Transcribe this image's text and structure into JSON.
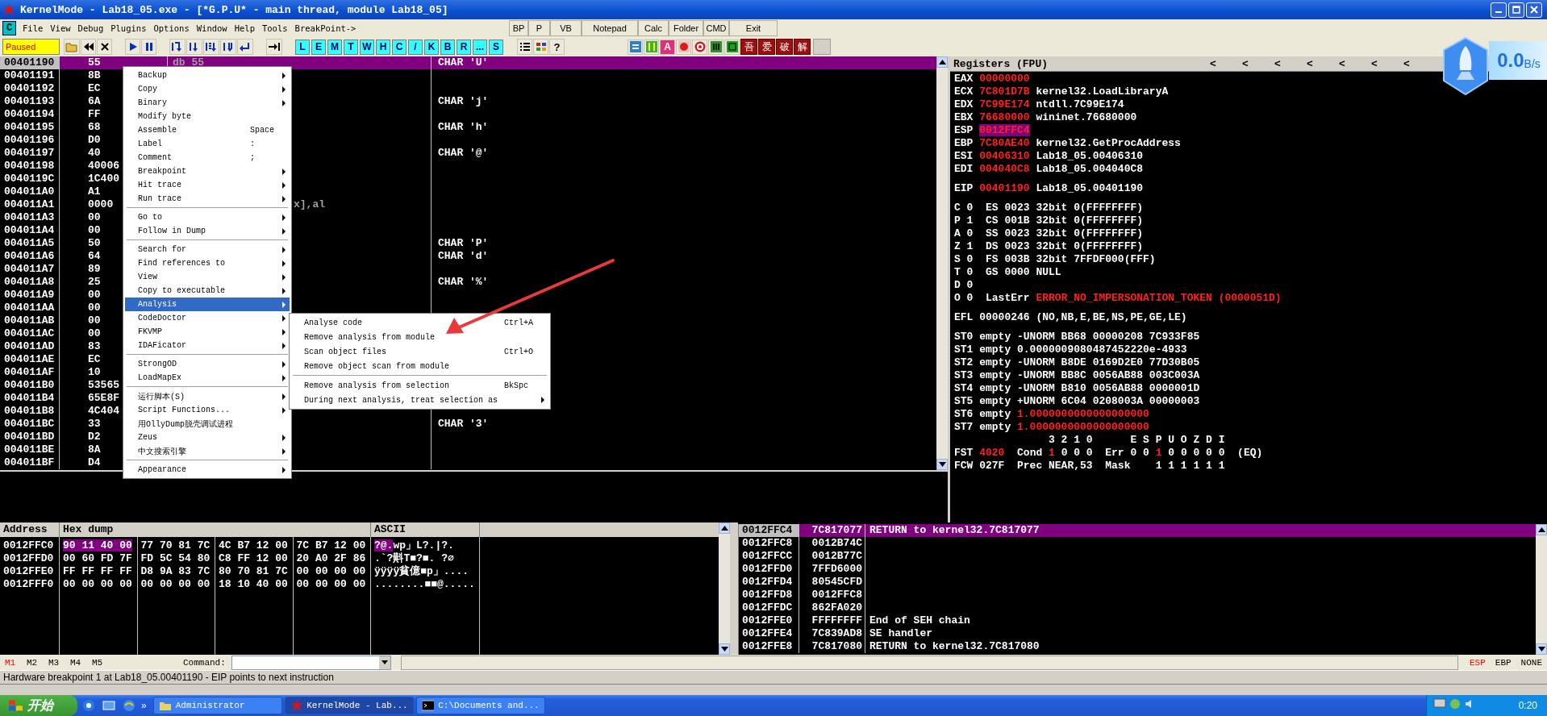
{
  "window": {
    "title": "KernelMode - Lab18_05.exe - [*G.P.U* - main thread, module Lab18_05]"
  },
  "menu": {
    "logo": "C",
    "items": [
      "File",
      "View",
      "Debug",
      "Plugins",
      "Options",
      "Window",
      "Help",
      "Tools",
      "BreakPoint->"
    ],
    "buttons": [
      "BP",
      "P",
      "VB",
      "Notepad",
      "Calc",
      "Folder",
      "CMD",
      "Exit"
    ]
  },
  "toolbar": {
    "status": "Paused",
    "letter_buttons": [
      "L",
      "E",
      "M",
      "T",
      "W",
      "H",
      "C",
      "/",
      "K",
      "B",
      "R",
      "...",
      "S"
    ],
    "help": "?",
    "plugin_letter": "A",
    "chinese_buttons": [
      "吾",
      "爱",
      "破",
      "解"
    ]
  },
  "disassembly": {
    "rows": [
      {
        "address": "00401190",
        "hex": "55",
        "code": "db 55",
        "comment": "CHAR 'U'",
        "selected": true
      },
      {
        "address": "00401191",
        "hex": "8B",
        "selected": false
      },
      {
        "address": "00401192",
        "hex": "EC",
        "selected": false
      },
      {
        "address": "00401193",
        "hex": "6A",
        "comment": "CHAR 'j'",
        "selected": false
      },
      {
        "address": "00401194",
        "hex": "FF",
        "selected": false
      },
      {
        "address": "00401195",
        "hex": "68",
        "comment": "CHAR 'h'",
        "selected": false
      },
      {
        "address": "00401196",
        "hex": "D0",
        "selected": false
      },
      {
        "address": "00401197",
        "hex": "40",
        "comment": "CHAR '@'",
        "selected": false
      },
      {
        "address": "00401198",
        "hex": "40006",
        "selected": false
      },
      {
        "address": "0040119C",
        "hex": "1C400",
        "selected": false
      },
      {
        "address": "004011A0",
        "hex": "A1",
        "selected": false
      },
      {
        "address": "004011A1",
        "hex": "0000",
        "code_tail": "x],al",
        "selected": false
      },
      {
        "address": "004011A3",
        "hex": "00",
        "selected": false
      },
      {
        "address": "004011A4",
        "hex": "00",
        "selected": false
      },
      {
        "address": "004011A5",
        "hex": "50",
        "comment": "CHAR 'P'",
        "selected": false
      },
      {
        "address": "004011A6",
        "hex": "64",
        "comment": "CHAR 'd'",
        "selected": false
      },
      {
        "address": "004011A7",
        "hex": "89",
        "selected": false
      },
      {
        "address": "004011A8",
        "hex": "25",
        "comment": "CHAR '%'",
        "selected": false
      },
      {
        "address": "004011A9",
        "hex": "00",
        "selected": false
      },
      {
        "address": "004011AA",
        "hex": "00",
        "selected": false
      },
      {
        "address": "004011AB",
        "hex": "00",
        "selected": false
      },
      {
        "address": "004011AC",
        "hex": "00",
        "selected": false
      },
      {
        "address": "004011AD",
        "hex": "83",
        "selected": false
      },
      {
        "address": "004011AE",
        "hex": "EC",
        "selected": false
      },
      {
        "address": "004011AF",
        "hex": "10",
        "selected": false
      },
      {
        "address": "004011B0",
        "hex": "53565",
        "selected": false
      },
      {
        "address": "004011B4",
        "hex": "65E8F",
        "selected": false
      },
      {
        "address": "004011B8",
        "hex": "4C404",
        "selected": false
      },
      {
        "address": "004011BC",
        "hex": "33",
        "comment": "CHAR '3'",
        "selected": false
      },
      {
        "address": "004011BD",
        "hex": "D2",
        "selected": false
      },
      {
        "address": "004011BE",
        "hex": "8A",
        "selected": false
      },
      {
        "address": "004011BF",
        "hex": "D4",
        "selected": false
      }
    ]
  },
  "context_menu": {
    "items": [
      {
        "kind": "item",
        "label": "Backup",
        "submenu": true,
        "selected": false
      },
      {
        "kind": "item",
        "label": "Copy",
        "submenu": true,
        "selected": false
      },
      {
        "kind": "item",
        "label": "Binary",
        "submenu": true,
        "selected": false
      },
      {
        "kind": "item",
        "label": "Modify byte",
        "submenu": false,
        "selected": false
      },
      {
        "kind": "item",
        "label": "Assemble",
        "shortcut": "Space",
        "submenu": false,
        "selected": false
      },
      {
        "kind": "item",
        "label": "Label",
        "shortcut": ":",
        "submenu": false,
        "selected": false
      },
      {
        "kind": "item",
        "label": "Comment",
        "shortcut": ";",
        "submenu": false,
        "selected": false
      },
      {
        "kind": "item",
        "label": "Breakpoint",
        "submenu": true,
        "selected": false
      },
      {
        "kind": "item",
        "label": "Hit trace",
        "submenu": true,
        "selected": false
      },
      {
        "kind": "item",
        "label": "Run trace",
        "submenu": true,
        "selected": false
      },
      {
        "kind": "separator"
      },
      {
        "kind": "item",
        "label": "Go to",
        "submenu": true,
        "selected": false
      },
      {
        "kind": "item",
        "label": "Follow in Dump",
        "submenu": true,
        "selected": false
      },
      {
        "kind": "separator"
      },
      {
        "kind": "item",
        "label": "Search for",
        "submenu": true,
        "selected": false
      },
      {
        "kind": "item",
        "label": "Find references to",
        "submenu": true,
        "selected": false
      },
      {
        "kind": "item",
        "label": "View",
        "submenu": true,
        "selected": false
      },
      {
        "kind": "item",
        "label": "Copy to executable",
        "submenu": true,
        "selected": false
      },
      {
        "kind": "item",
        "label": "Analysis",
        "submenu": true,
        "selected": true
      },
      {
        "kind": "item",
        "label": "CodeDoctor",
        "submenu": true,
        "selected": false
      },
      {
        "kind": "item",
        "label": "FKVMP",
        "submenu": true,
        "selected": false
      },
      {
        "kind": "item",
        "label": "IDAFicator",
        "submenu": true,
        "selected": false
      },
      {
        "kind": "separator"
      },
      {
        "kind": "item",
        "label": "StrongOD",
        "submenu": true,
        "selected": false
      },
      {
        "kind": "item",
        "label": "LoadMapEx",
        "submenu": true,
        "selected": false
      },
      {
        "kind": "separator"
      },
      {
        "kind": "item",
        "label": "运行脚本(S)",
        "submenu": true,
        "selected": false
      },
      {
        "kind": "item",
        "label": "Script Functions...",
        "submenu": true,
        "selected": false
      },
      {
        "kind": "item",
        "label": "用OllyDump脱壳调试进程",
        "submenu": false,
        "selected": false
      },
      {
        "kind": "item",
        "label": "Zeus",
        "submenu": true,
        "selected": false
      },
      {
        "kind": "item",
        "label": "中文搜索引擎",
        "submenu": true,
        "selected": false
      },
      {
        "kind": "separator"
      },
      {
        "kind": "item",
        "label": "Appearance",
        "submenu": true,
        "selected": false
      }
    ]
  },
  "submenu": {
    "items": [
      {
        "kind": "item",
        "label": "Analyse code",
        "shortcut": "Ctrl+A",
        "submenu": false,
        "selected": false
      },
      {
        "kind": "item",
        "label": "Remove analysis from module",
        "submenu": false,
        "selected": false
      },
      {
        "kind": "item",
        "label": "Scan object files",
        "shortcut": "Ctrl+O",
        "submenu": false,
        "selected": false
      },
      {
        "kind": "item",
        "label": "Remove object scan from module",
        "submenu": false,
        "selected": false
      },
      {
        "kind": "separator"
      },
      {
        "kind": "item",
        "label": "Remove analysis from selection",
        "shortcut": "BkSpc",
        "submenu": false,
        "selected": false
      },
      {
        "kind": "item",
        "label": "During next analysis, treat selection as",
        "submenu": true,
        "selected": false
      }
    ]
  },
  "registers": {
    "title": "Registers (FPU)",
    "arrows": [
      "<",
      "<",
      "<",
      "<",
      "<",
      "<",
      "<"
    ],
    "groups": [
      [
        {
          "parts": [
            {
              "text": "EAX ",
              "kind": "plain"
            },
            {
              "text": "00000000",
              "kind": "changed"
            }
          ]
        },
        {
          "parts": [
            {
              "text": "ECX ",
              "kind": "plain"
            },
            {
              "text": "7C801D7B",
              "kind": "changed"
            },
            {
              "text": " kernel32.LoadLibraryA",
              "kind": "plain"
            }
          ]
        },
        {
          "parts": [
            {
              "text": "EDX ",
              "kind": "plain"
            },
            {
              "text": "7C99E174",
              "kind": "changed"
            },
            {
              "text": " ntdll.7C99E174",
              "kind": "plain"
            }
          ]
        },
        {
          "parts": [
            {
              "text": "EBX ",
              "kind": "plain"
            },
            {
              "text": "76680000",
              "kind": "changed"
            },
            {
              "text": " wininet.76680000",
              "kind": "plain"
            }
          ]
        },
        {
          "parts": [
            {
              "text": "ESP ",
              "kind": "plain"
            },
            {
              "text": "0012FFC4",
              "kind": "highlight"
            }
          ]
        },
        {
          "parts": [
            {
              "text": "EBP ",
              "kind": "plain"
            },
            {
              "text": "7C80AE40",
              "kind": "changed"
            },
            {
              "text": " kernel32.GetProcAddress",
              "kind": "plain"
            }
          ]
        },
        {
          "parts": [
            {
              "text": "ESI ",
              "kind": "plain"
            },
            {
              "text": "00406310",
              "kind": "changed"
            },
            {
              "text": " Lab18_05.00406310",
              "kind": "plain"
            }
          ]
        },
        {
          "parts": [
            {
              "text": "EDI ",
              "kind": "plain"
            },
            {
              "text": "004040C8",
              "kind": "changed"
            },
            {
              "text": " Lab18_05.004040C8",
              "kind": "plain"
            }
          ]
        }
      ],
      [
        {
          "parts": [
            {
              "text": "EIP ",
              "kind": "plain"
            },
            {
              "text": "00401190",
              "kind": "changed"
            },
            {
              "text": " Lab18_05.00401190",
              "kind": "plain"
            }
          ]
        }
      ],
      [
        {
          "parts": [
            {
              "text": "C 0  ES 0023 32bit 0(FFFFFFFF)",
              "kind": "plain"
            }
          ]
        },
        {
          "parts": [
            {
              "text": "P 1  CS 001B 32bit 0(FFFFFFFF)",
              "kind": "plain"
            }
          ]
        },
        {
          "parts": [
            {
              "text": "A 0  SS 0023 32bit 0(FFFFFFFF)",
              "kind": "plain"
            }
          ]
        },
        {
          "parts": [
            {
              "text": "Z 1  DS 0023 32bit 0(FFFFFFFF)",
              "kind": "plain"
            }
          ]
        },
        {
          "parts": [
            {
              "text": "S 0  FS 003B 32bit 7FFDF000(FFF)",
              "kind": "plain"
            }
          ]
        },
        {
          "parts": [
            {
              "text": "T 0  GS 0000 NULL",
              "kind": "plain"
            }
          ]
        },
        {
          "parts": [
            {
              "text": "D 0",
              "kind": "plain"
            }
          ]
        },
        {
          "parts": [
            {
              "text": "O 0  LastErr ",
              "kind": "plain"
            },
            {
              "text": "ERROR_NO_IMPERSONATION_TOKEN (0000051D)",
              "kind": "changed"
            }
          ]
        }
      ],
      [
        {
          "parts": [
            {
              "text": "EFL 00000246 (NO,NB,E,BE,NS,PE,GE,LE)",
              "kind": "plain"
            }
          ]
        }
      ],
      [
        {
          "parts": [
            {
              "text": "ST0 empty -UNORM BB68 00000208 7C933F85",
              "kind": "plain"
            }
          ]
        },
        {
          "parts": [
            {
              "text": "ST1 empty 0.0000009080487452220e-4933",
              "kind": "plain"
            }
          ]
        },
        {
          "parts": [
            {
              "text": "ST2 empty -UNORM B8DE 0169D2E0 77D30B05",
              "kind": "plain"
            }
          ]
        },
        {
          "parts": [
            {
              "text": "ST3 empty -UNORM BB8C 0056AB88 003C003A",
              "kind": "plain"
            }
          ]
        },
        {
          "parts": [
            {
              "text": "ST4 empty -UNORM B810 0056AB88 0000001D",
              "kind": "plain"
            }
          ]
        },
        {
          "parts": [
            {
              "text": "ST5 empty +UNORM 6C04 0208003A 00000003",
              "kind": "plain"
            }
          ]
        },
        {
          "parts": [
            {
              "text": "ST6 empty ",
              "kind": "plain"
            },
            {
              "text": "1.0000000000000000000",
              "kind": "changed"
            }
          ]
        },
        {
          "parts": [
            {
              "text": "ST7 empty ",
              "kind": "plain"
            },
            {
              "text": "1.0000000000000000000",
              "kind": "changed"
            }
          ]
        },
        {
          "parts": [
            {
              "text": "               3 2 1 0      E S P U O Z D I",
              "kind": "plain"
            }
          ]
        },
        {
          "parts": [
            {
              "text": "FST ",
              "kind": "plain"
            },
            {
              "text": "4020",
              "kind": "changed"
            },
            {
              "text": "  Cond ",
              "kind": "plain"
            },
            {
              "text": "1",
              "kind": "changed"
            },
            {
              "text": " 0 0 0  Err 0 0 ",
              "kind": "plain"
            },
            {
              "text": "1",
              "kind": "changed"
            },
            {
              "text": " 0 0 0 0 0  (EQ)",
              "kind": "plain"
            }
          ]
        },
        {
          "parts": [
            {
              "text": "FCW 027F  Prec NEAR,53  Mask    1 1 1 1 1 1",
              "kind": "plain"
            }
          ]
        }
      ]
    ]
  },
  "speed_widget": {
    "value": "0.0",
    "unit": "B/s"
  },
  "dump": {
    "columns": [
      "Address",
      "Hex dump",
      "ASCII"
    ],
    "rows": [
      {
        "address": "0012FFC0",
        "groups": [
          {
            "bytes": "90 11 40 00",
            "selected": true
          },
          {
            "bytes": "77 70 81 7C",
            "selected": false
          },
          {
            "bytes": "4C B7 12 00",
            "selected": false
          },
          {
            "bytes": "7C B7 12 00",
            "selected": false
          }
        ],
        "ascii": [
          {
            "text": "?@.",
            "selected": true
          },
          {
            "text": "wp」L?.|?.",
            "selected": false
          }
        ]
      },
      {
        "address": "0012FFD0",
        "groups": [
          {
            "bytes": "00 60 FD 7F",
            "selected": false
          },
          {
            "bytes": "FD 5C 54 80",
            "selected": false
          },
          {
            "bytes": "C8 FF 12 00",
            "selected": false
          },
          {
            "bytes": "20 A0 2F 86",
            "selected": false
          }
        ],
        "ascii": [
          {
            "text": ".`?斢T■?■. ?∅",
            "selected": false
          }
        ]
      },
      {
        "address": "0012FFE0",
        "groups": [
          {
            "bytes": "FF FF FF FF",
            "selected": false
          },
          {
            "bytes": "D8 9A 83 7C",
            "selected": false
          },
          {
            "bytes": "80 70 81 7C",
            "selected": false
          },
          {
            "bytes": "00 00 00 00",
            "selected": false
          }
        ],
        "ascii": [
          {
            "text": "ÿÿÿÿ貧億■p」....",
            "selected": false
          }
        ]
      },
      {
        "address": "0012FFF0",
        "groups": [
          {
            "bytes": "00 00 00 00",
            "selected": false
          },
          {
            "bytes": "00 00 00 00",
            "selected": false
          },
          {
            "bytes": "18 10 40 00",
            "selected": false
          },
          {
            "bytes": "00 00 00 00",
            "selected": false
          }
        ],
        "ascii": [
          {
            "text": "........■■@.....",
            "selected": false
          }
        ]
      }
    ]
  },
  "stack": {
    "rows": [
      {
        "address": "0012FFC4",
        "value": "7C817077",
        "comment": "RETURN to kernel32.7C817077",
        "selected": true
      },
      {
        "address": "0012FFC8",
        "value": "0012B74C",
        "selected": false
      },
      {
        "address": "0012FFCC",
        "value": "0012B77C",
        "selected": false
      },
      {
        "address": "0012FFD0",
        "value": "7FFD6000",
        "selected": false
      },
      {
        "address": "0012FFD4",
        "value": "80545CFD",
        "selected": false
      },
      {
        "address": "0012FFD8",
        "value": "0012FFC8",
        "selected": false
      },
      {
        "address": "0012FFDC",
        "value": "862FA020",
        "selected": false
      },
      {
        "address": "0012FFE0",
        "value": "FFFFFFFF",
        "comment": "End of SEH chain",
        "selected": false
      },
      {
        "address": "0012FFE4",
        "value": "7C839AD8",
        "comment": "SE handler",
        "selected": false
      },
      {
        "address": "0012FFE8",
        "value": "7C817080",
        "comment": "RETURN to kernel32.7C817080",
        "selected": false
      }
    ]
  },
  "command_bar": {
    "markers": [
      {
        "label": "M1",
        "selected": true
      },
      {
        "label": "M2",
        "selected": false
      },
      {
        "label": "M3",
        "selected": false
      },
      {
        "label": "M4",
        "selected": false
      },
      {
        "label": "M5",
        "selected": false
      }
    ],
    "label": "Command:",
    "registers": [
      {
        "label": "ESP",
        "selected": true
      },
      {
        "label": "EBP",
        "selected": false
      },
      {
        "label": "NONE",
        "selected": false
      }
    ]
  },
  "status_bar": {
    "text": "Hardware breakpoint 1 at Lab18_05.00401190 - EIP points to next instruction"
  },
  "taskbar": {
    "start": "开始",
    "more": "»",
    "tasks": [
      {
        "label": "Administrator",
        "kind": "folder",
        "selected": false
      },
      {
        "label": "KernelMode - Lab...",
        "kind": "debugger",
        "selected": true
      },
      {
        "label": "C:\\Documents and...",
        "kind": "console",
        "selected": false
      }
    ],
    "clock": "0:20"
  }
}
